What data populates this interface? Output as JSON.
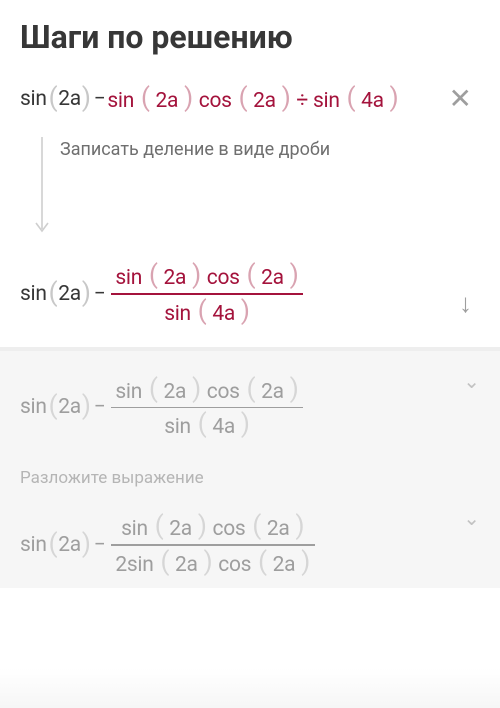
{
  "title": "Шаги по решению",
  "step1": {
    "sin": "sin",
    "cos": "cos",
    "a2": "2a",
    "a4": "4a",
    "minus": "−",
    "div": "÷",
    "desc": "Записать деление в виде дроби"
  },
  "future": {
    "desc": "Разложите выражение",
    "denom2": "2sin",
    "cos": "cos"
  }
}
